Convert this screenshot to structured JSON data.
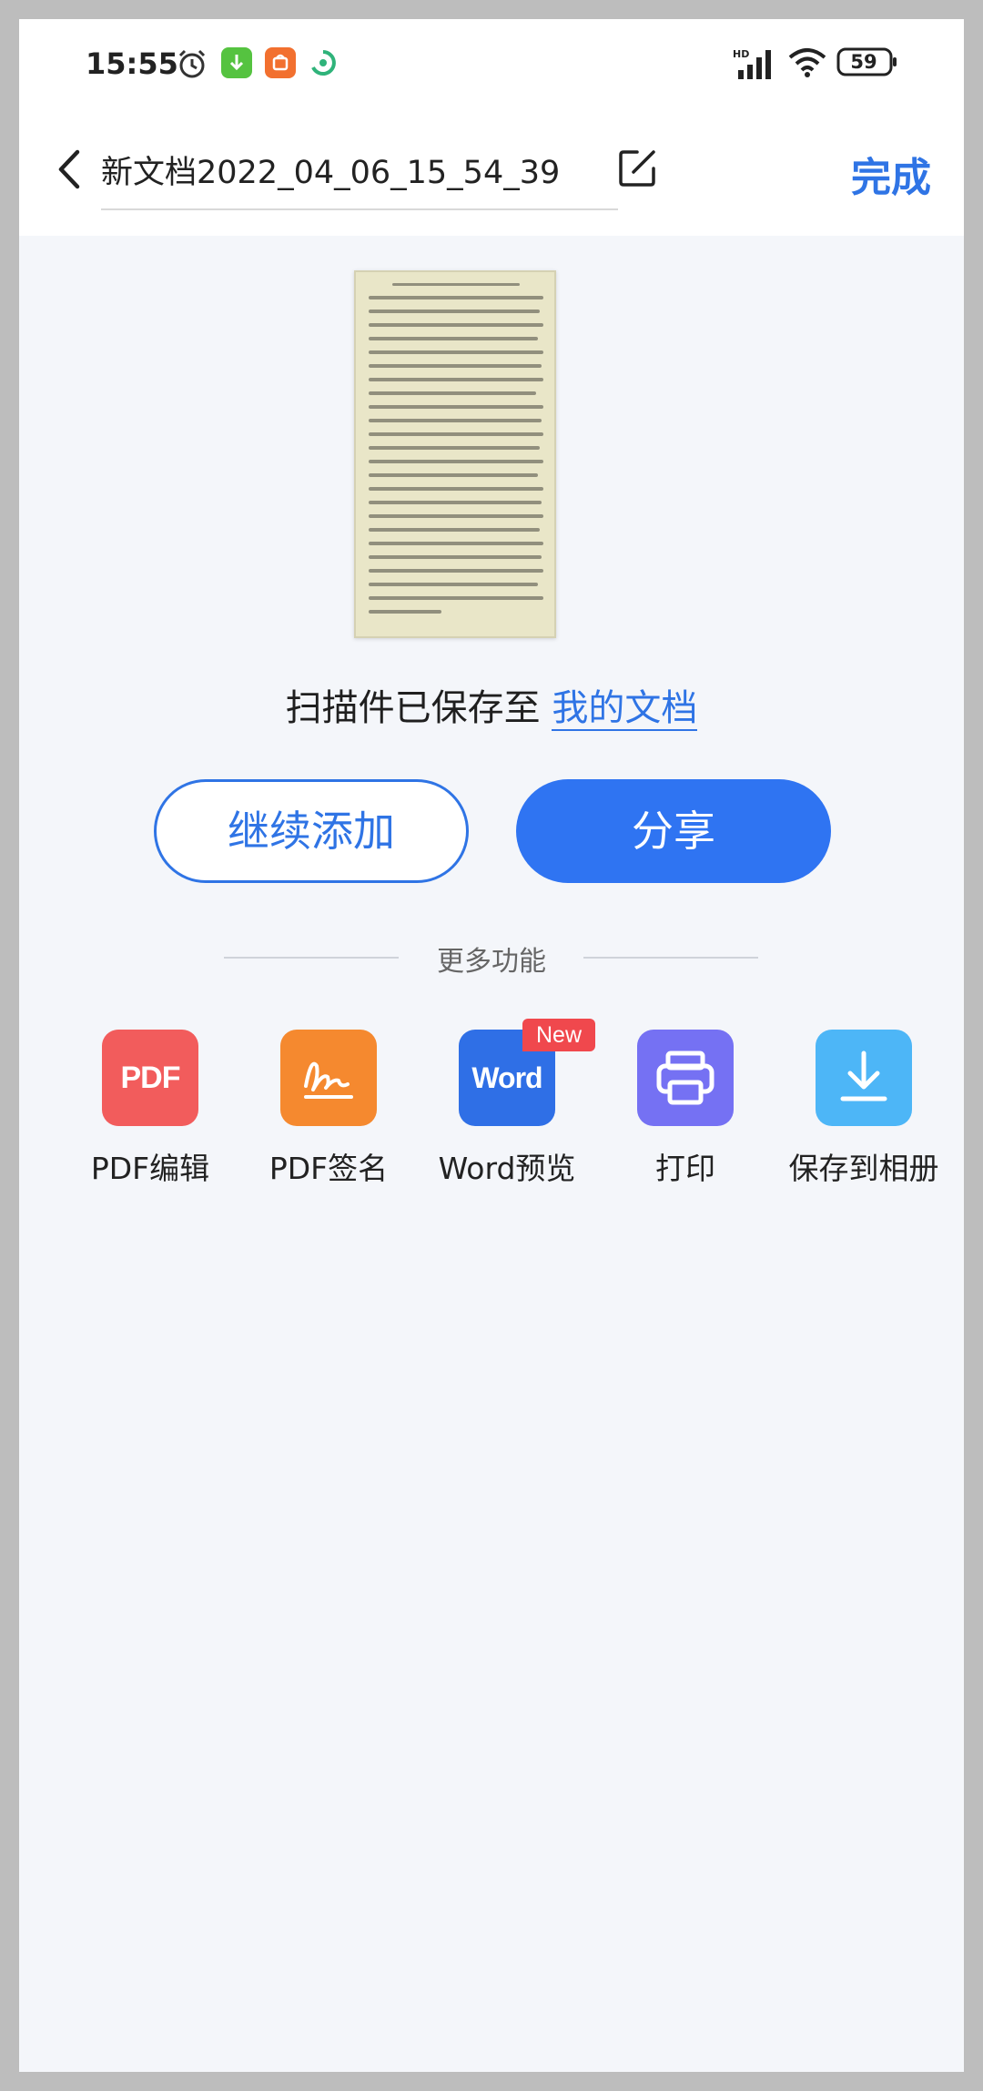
{
  "status": {
    "time": "15:55",
    "battery": "59"
  },
  "header": {
    "title": "新文档2022_04_06_15_54_39",
    "done_label": "完成"
  },
  "saved": {
    "prefix": "扫描件已保存至 ",
    "link": "我的文档"
  },
  "actions": {
    "continue_label": "继续添加",
    "share_label": "分享"
  },
  "more": {
    "label": "更多功能",
    "tools": [
      {
        "label": "PDF编辑",
        "icon": "pdf-icon",
        "icon_text": "PDF",
        "color": "#f25c5c"
      },
      {
        "label": "PDF签名",
        "icon": "signature-icon",
        "color": "#f5892f"
      },
      {
        "label": "Word预览",
        "icon": "word-icon",
        "icon_text": "Word",
        "badge": "New",
        "color": "#2f6fe6"
      },
      {
        "label": "打印",
        "icon": "printer-icon",
        "color": "#7571f3"
      },
      {
        "label": "保存到相册",
        "icon": "download-icon",
        "color": "#4db6f7"
      }
    ]
  },
  "colors": {
    "accent": "#2f74e5",
    "page_bg": "#f4f6fa"
  }
}
